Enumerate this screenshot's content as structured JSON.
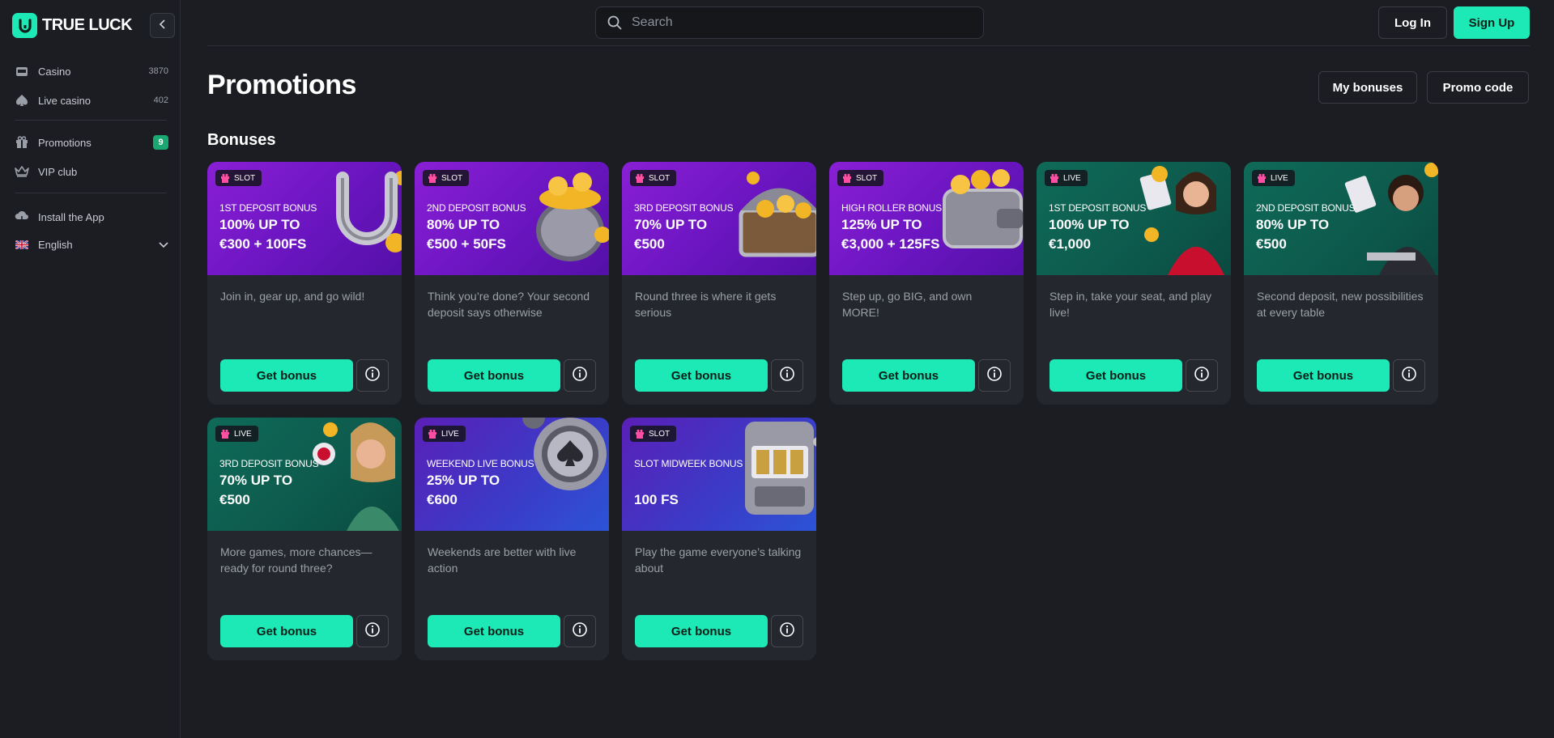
{
  "brand": {
    "name": "TRUE LUCK",
    "accent": "#1de9b6"
  },
  "sidebar": {
    "items": [
      {
        "label": "Casino",
        "count": "3870",
        "icon": "casino-icon"
      },
      {
        "label": "Live casino",
        "count": "402",
        "icon": "spade-icon"
      },
      {
        "label": "Promotions",
        "badge": "9",
        "icon": "gift-icon"
      },
      {
        "label": "VIP club",
        "icon": "crown-icon"
      },
      {
        "label": "Install the App",
        "icon": "cloud-download-icon"
      },
      {
        "label": "English",
        "icon": "uk-flag-icon"
      }
    ]
  },
  "header": {
    "search_placeholder": "Search",
    "login_label": "Log In",
    "signup_label": "Sign Up"
  },
  "page": {
    "title": "Promotions",
    "my_bonuses_label": "My bonuses",
    "promo_code_label": "Promo code",
    "section_title": "Bonuses"
  },
  "bonuses": [
    {
      "type": "SLOT",
      "subtitle": "1ST DEPOSIT BONUS",
      "line1": "100% UP TO",
      "line2": "€300 + 100FS",
      "description": "Join in, gear up, and go wild!",
      "button": "Get bonus",
      "art": "horseshoe"
    },
    {
      "type": "SLOT",
      "subtitle": "2ND DEPOSIT BONUS",
      "line1": "80% UP TO",
      "line2": "€500 + 50FS",
      "description": "Think you’re done? Your second deposit says otherwise",
      "button": "Get bonus",
      "art": "pot-of-gold"
    },
    {
      "type": "SLOT",
      "subtitle": "3RD DEPOSIT BONUS",
      "line1": "70% UP TO",
      "line2": "€500",
      "description": "Round three is where it gets serious",
      "button": "Get bonus",
      "art": "treasure-chest"
    },
    {
      "type": "SLOT",
      "subtitle": "HIGH ROLLER BONUS",
      "line1": "125% UP TO",
      "line2": "€3,000 + 125FS",
      "description": "Step up, go BIG, and own MORE!",
      "button": "Get bonus",
      "art": "wallet"
    },
    {
      "type": "LIVE",
      "subtitle": "1ST DEPOSIT BONUS",
      "line1": "100% UP TO",
      "line2": "€1,000",
      "description": "Step in, take your seat, and play live!",
      "button": "Get bonus",
      "art": "dealer"
    },
    {
      "type": "LIVE",
      "subtitle": "2ND DEPOSIT BONUS",
      "line1": "80% UP TO",
      "line2": "€500",
      "description": "Second deposit, new possibilities at every table",
      "button": "Get bonus",
      "art": "dealer"
    },
    {
      "type": "LIVE",
      "subtitle": "3RD DEPOSIT BONUS",
      "line1": "70% UP TO",
      "line2": "€500",
      "description": "More games, more chances—ready for round three?",
      "button": "Get bonus",
      "art": "dealer"
    },
    {
      "type": "LIVE",
      "subtitle": "WEEKEND LIVE BONUS",
      "line1": "25% UP TO",
      "line2": "€600",
      "description": "Weekends are better with live action",
      "button": "Get bonus",
      "art": "poker-chip"
    },
    {
      "type": "SLOT",
      "subtitle": "SLOT MIDWEEK BONUS",
      "line1": "",
      "line2": "100 FS",
      "description": "Play the game everyone’s talking about",
      "button": "Get bonus",
      "art": "slot-machine"
    }
  ]
}
